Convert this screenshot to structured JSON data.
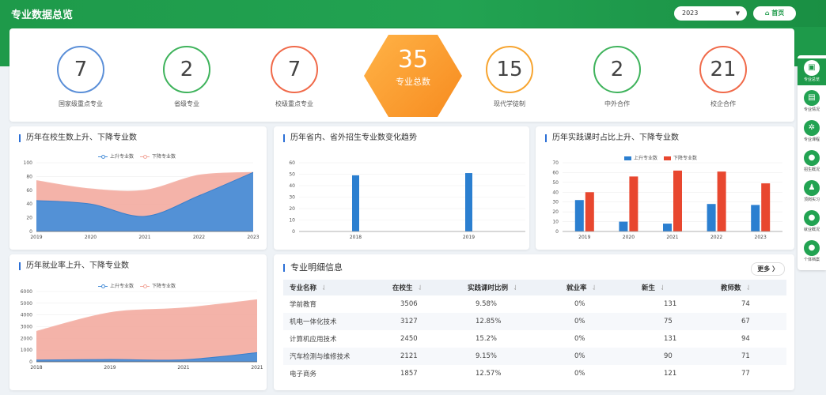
{
  "header": {
    "title": "专业数据总览",
    "year": "2023",
    "home_label": "首页"
  },
  "stats": [
    {
      "value": "7",
      "label": "国家级重点专业",
      "color": "#5b8fd8"
    },
    {
      "value": "2",
      "label": "省级专业",
      "color": "#3fb35c"
    },
    {
      "value": "7",
      "label": "校级重点专业",
      "color": "#f06a4a"
    },
    {
      "value": "15",
      "label": "现代学徒制",
      "color": "#f7a531"
    },
    {
      "value": "2",
      "label": "中外合作",
      "color": "#3fb35c"
    },
    {
      "value": "21",
      "label": "校企合作",
      "color": "#f06a4a"
    }
  ],
  "total": {
    "value": "35",
    "label": "专业总数"
  },
  "panels": {
    "p1_title": "历年在校生数上升、下降专业数",
    "p2_title": "历年省内、省外招生专业数变化趋势",
    "p3_title": "历年实践课时占比上升、下降专业数",
    "p4_title": "历年就业率上升、下降专业数",
    "p5_title": "专业明细信息",
    "more_label": "更多 〉"
  },
  "legend": {
    "up": "上升专业数",
    "down": "下降专业数"
  },
  "chart_data": [
    {
      "type": "area",
      "x": [
        "2019",
        "2020",
        "2021",
        "2022",
        "2023"
      ],
      "ylim": [
        0,
        100
      ],
      "yticks": [
        0,
        20,
        40,
        60,
        80,
        100
      ],
      "series": [
        {
          "name": "上升专业数",
          "values": [
            45,
            40,
            22,
            52,
            86
          ],
          "color": "#4a8fd8"
        },
        {
          "name": "下降专业数",
          "values": [
            74,
            62,
            60,
            82,
            86
          ],
          "color": "#f2a69a"
        }
      ]
    },
    {
      "type": "bar",
      "categories": [
        "2018",
        "2019"
      ],
      "ylim": [
        0,
        60
      ],
      "yticks": [
        0,
        10,
        20,
        30,
        40,
        50,
        60
      ],
      "values": [
        49,
        51
      ],
      "color": "#2b7fd0"
    },
    {
      "type": "bar",
      "categories": [
        "2019",
        "2020",
        "2021",
        "2022",
        "2023"
      ],
      "ylim": [
        0,
        70
      ],
      "yticks": [
        0,
        10,
        20,
        30,
        40,
        50,
        60,
        70
      ],
      "series": [
        {
          "name": "上升专业数",
          "values": [
            32,
            10,
            8,
            28,
            27
          ],
          "color": "#2b7fd0"
        },
        {
          "name": "下降专业数",
          "values": [
            40,
            56,
            62,
            61,
            49
          ],
          "color": "#e8472f"
        }
      ]
    },
    {
      "type": "area",
      "x": [
        "2018",
        "2019",
        "2021",
        "2021"
      ],
      "ylim": [
        0,
        6000
      ],
      "yticks": [
        0,
        1000,
        2000,
        3000,
        4000,
        5000,
        6000
      ],
      "series": [
        {
          "name": "上升专业数",
          "values": [
            150,
            200,
            180,
            780
          ],
          "color": "#4a8fd8"
        },
        {
          "name": "下降专业数",
          "values": [
            2600,
            4200,
            4600,
            5300
          ],
          "color": "#f2a69a"
        }
      ]
    }
  ],
  "table": {
    "headers": [
      "专业名称",
      "在校生",
      "实践课时比例",
      "就业率",
      "新生",
      "教师数"
    ],
    "rows": [
      [
        "学前教育",
        "3506",
        "9.58%",
        "0%",
        "131",
        "74"
      ],
      [
        "机电一体化技术",
        "3127",
        "12.85%",
        "0%",
        "75",
        "67"
      ],
      [
        "计算机应用技术",
        "2450",
        "15.2%",
        "0%",
        "131",
        "94"
      ],
      [
        "汽车检测与维修技术",
        "2121",
        "9.15%",
        "0%",
        "90",
        "71"
      ],
      [
        "电子商务",
        "1857",
        "12.57%",
        "0%",
        "121",
        "77"
      ]
    ]
  },
  "sidenav": [
    {
      "label": "专业总览",
      "icon": "monitor-icon",
      "glyph": "▣",
      "active": true
    },
    {
      "label": "专业情况",
      "icon": "book-icon",
      "glyph": "▤",
      "active": false
    },
    {
      "label": "专业课程",
      "icon": "atom-icon",
      "glyph": "✲",
      "active": false
    },
    {
      "label": "招生概况",
      "icon": "user-icon",
      "glyph": "●",
      "active": false
    },
    {
      "label": "顶岗实习",
      "icon": "worker-icon",
      "glyph": "♟",
      "active": false
    },
    {
      "label": "就业概况",
      "icon": "user-icon",
      "glyph": "●",
      "active": false
    },
    {
      "label": "个体档案",
      "icon": "user-icon",
      "glyph": "●",
      "active": false
    }
  ]
}
